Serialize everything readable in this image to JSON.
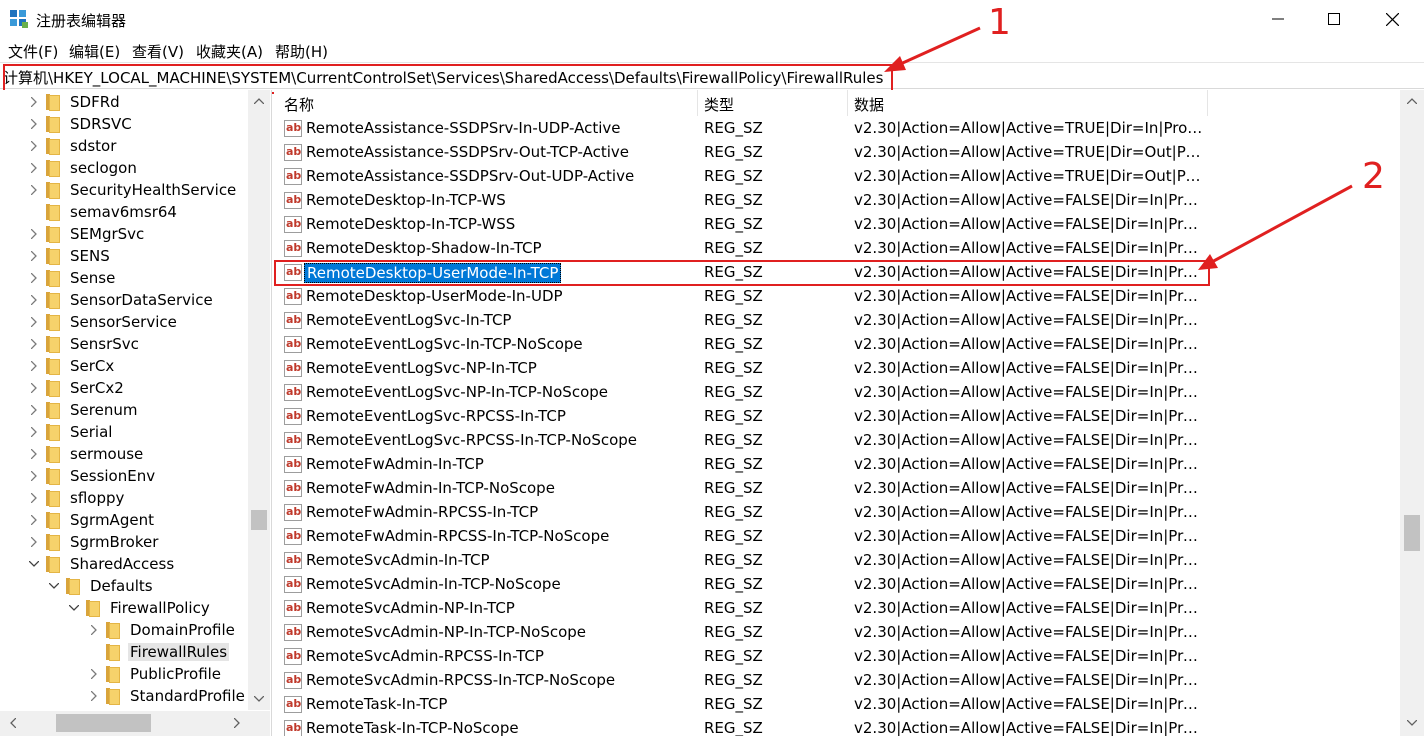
{
  "window": {
    "title": "注册表编辑器"
  },
  "menu": [
    "文件(F)",
    "编辑(E)",
    "查看(V)",
    "收藏夹(A)",
    "帮助(H)"
  ],
  "address": "计算机\\HKEY_LOCAL_MACHINE\\SYSTEM\\CurrentControlSet\\Services\\SharedAccess\\Defaults\\FirewallPolicy\\FirewallRules",
  "tree": [
    {
      "label": "SDFRd",
      "level": 0,
      "expand": "collapsed"
    },
    {
      "label": "SDRSVC",
      "level": 0,
      "expand": "collapsed"
    },
    {
      "label": "sdstor",
      "level": 0,
      "expand": "collapsed"
    },
    {
      "label": "seclogon",
      "level": 0,
      "expand": "collapsed"
    },
    {
      "label": "SecurityHealthService",
      "level": 0,
      "expand": "collapsed"
    },
    {
      "label": "semav6msr64",
      "level": 0,
      "expand": "none"
    },
    {
      "label": "SEMgrSvc",
      "level": 0,
      "expand": "collapsed"
    },
    {
      "label": "SENS",
      "level": 0,
      "expand": "collapsed"
    },
    {
      "label": "Sense",
      "level": 0,
      "expand": "collapsed"
    },
    {
      "label": "SensorDataService",
      "level": 0,
      "expand": "collapsed"
    },
    {
      "label": "SensorService",
      "level": 0,
      "expand": "collapsed"
    },
    {
      "label": "SensrSvc",
      "level": 0,
      "expand": "collapsed"
    },
    {
      "label": "SerCx",
      "level": 0,
      "expand": "collapsed"
    },
    {
      "label": "SerCx2",
      "level": 0,
      "expand": "collapsed"
    },
    {
      "label": "Serenum",
      "level": 0,
      "expand": "collapsed"
    },
    {
      "label": "Serial",
      "level": 0,
      "expand": "collapsed"
    },
    {
      "label": "sermouse",
      "level": 0,
      "expand": "collapsed"
    },
    {
      "label": "SessionEnv",
      "level": 0,
      "expand": "collapsed"
    },
    {
      "label": "sfloppy",
      "level": 0,
      "expand": "collapsed"
    },
    {
      "label": "SgrmAgent",
      "level": 0,
      "expand": "collapsed"
    },
    {
      "label": "SgrmBroker",
      "level": 0,
      "expand": "collapsed"
    },
    {
      "label": "SharedAccess",
      "level": 0,
      "expand": "expanded"
    },
    {
      "label": "Defaults",
      "level": 1,
      "expand": "expanded"
    },
    {
      "label": "FirewallPolicy",
      "level": 2,
      "expand": "expanded"
    },
    {
      "label": "DomainProfile",
      "level": 3,
      "expand": "collapsed"
    },
    {
      "label": "FirewallRules",
      "level": 3,
      "expand": "none",
      "selected": true
    },
    {
      "label": "PublicProfile",
      "level": 3,
      "expand": "collapsed"
    },
    {
      "label": "StandardProfile",
      "level": 3,
      "expand": "collapsed"
    }
  ],
  "columns": {
    "name": "名称",
    "type": "类型",
    "data": "数据"
  },
  "rows": [
    {
      "name": "RemoteAssistance-SSDPSrv-In-UDP-Active",
      "type": "REG_SZ",
      "data": "v2.30|Action=Allow|Active=TRUE|Dir=In|Proto..."
    },
    {
      "name": "RemoteAssistance-SSDPSrv-Out-TCP-Active",
      "type": "REG_SZ",
      "data": "v2.30|Action=Allow|Active=TRUE|Dir=Out|Pro..."
    },
    {
      "name": "RemoteAssistance-SSDPSrv-Out-UDP-Active",
      "type": "REG_SZ",
      "data": "v2.30|Action=Allow|Active=TRUE|Dir=Out|Pro..."
    },
    {
      "name": "RemoteDesktop-In-TCP-WS",
      "type": "REG_SZ",
      "data": "v2.30|Action=Allow|Active=FALSE|Dir=In|Prot..."
    },
    {
      "name": "RemoteDesktop-In-TCP-WSS",
      "type": "REG_SZ",
      "data": "v2.30|Action=Allow|Active=FALSE|Dir=In|Prot..."
    },
    {
      "name": "RemoteDesktop-Shadow-In-TCP",
      "type": "REG_SZ",
      "data": "v2.30|Action=Allow|Active=FALSE|Dir=In|Prot..."
    },
    {
      "name": "RemoteDesktop-UserMode-In-TCP",
      "type": "REG_SZ",
      "data": "v2.30|Action=Allow|Active=FALSE|Dir=In|Prot...",
      "selected": true
    },
    {
      "name": "RemoteDesktop-UserMode-In-UDP",
      "type": "REG_SZ",
      "data": "v2.30|Action=Allow|Active=FALSE|Dir=In|Prot..."
    },
    {
      "name": "RemoteEventLogSvc-In-TCP",
      "type": "REG_SZ",
      "data": "v2.30|Action=Allow|Active=FALSE|Dir=In|Prot..."
    },
    {
      "name": "RemoteEventLogSvc-In-TCP-NoScope",
      "type": "REG_SZ",
      "data": "v2.30|Action=Allow|Active=FALSE|Dir=In|Prot..."
    },
    {
      "name": "RemoteEventLogSvc-NP-In-TCP",
      "type": "REG_SZ",
      "data": "v2.30|Action=Allow|Active=FALSE|Dir=In|Prot..."
    },
    {
      "name": "RemoteEventLogSvc-NP-In-TCP-NoScope",
      "type": "REG_SZ",
      "data": "v2.30|Action=Allow|Active=FALSE|Dir=In|Prot..."
    },
    {
      "name": "RemoteEventLogSvc-RPCSS-In-TCP",
      "type": "REG_SZ",
      "data": "v2.30|Action=Allow|Active=FALSE|Dir=In|Prot..."
    },
    {
      "name": "RemoteEventLogSvc-RPCSS-In-TCP-NoScope",
      "type": "REG_SZ",
      "data": "v2.30|Action=Allow|Active=FALSE|Dir=In|Prot..."
    },
    {
      "name": "RemoteFwAdmin-In-TCP",
      "type": "REG_SZ",
      "data": "v2.30|Action=Allow|Active=FALSE|Dir=In|Prot..."
    },
    {
      "name": "RemoteFwAdmin-In-TCP-NoScope",
      "type": "REG_SZ",
      "data": "v2.30|Action=Allow|Active=FALSE|Dir=In|Prot..."
    },
    {
      "name": "RemoteFwAdmin-RPCSS-In-TCP",
      "type": "REG_SZ",
      "data": "v2.30|Action=Allow|Active=FALSE|Dir=In|Prot..."
    },
    {
      "name": "RemoteFwAdmin-RPCSS-In-TCP-NoScope",
      "type": "REG_SZ",
      "data": "v2.30|Action=Allow|Active=FALSE|Dir=In|Prot..."
    },
    {
      "name": "RemoteSvcAdmin-In-TCP",
      "type": "REG_SZ",
      "data": "v2.30|Action=Allow|Active=FALSE|Dir=In|Prot..."
    },
    {
      "name": "RemoteSvcAdmin-In-TCP-NoScope",
      "type": "REG_SZ",
      "data": "v2.30|Action=Allow|Active=FALSE|Dir=In|Prot..."
    },
    {
      "name": "RemoteSvcAdmin-NP-In-TCP",
      "type": "REG_SZ",
      "data": "v2.30|Action=Allow|Active=FALSE|Dir=In|Prot..."
    },
    {
      "name": "RemoteSvcAdmin-NP-In-TCP-NoScope",
      "type": "REG_SZ",
      "data": "v2.30|Action=Allow|Active=FALSE|Dir=In|Prot..."
    },
    {
      "name": "RemoteSvcAdmin-RPCSS-In-TCP",
      "type": "REG_SZ",
      "data": "v2.30|Action=Allow|Active=FALSE|Dir=In|Prot..."
    },
    {
      "name": "RemoteSvcAdmin-RPCSS-In-TCP-NoScope",
      "type": "REG_SZ",
      "data": "v2.30|Action=Allow|Active=FALSE|Dir=In|Prot..."
    },
    {
      "name": "RemoteTask-In-TCP",
      "type": "REG_SZ",
      "data": "v2.30|Action=Allow|Active=FALSE|Dir=In|Prot..."
    },
    {
      "name": "RemoteTask-In-TCP-NoScope",
      "type": "REG_SZ",
      "data": "v2.30|Action=Allow|Active=FALSE|Dir=In|Prot..."
    }
  ],
  "value_icon_text": "ab",
  "annotations": [
    "1",
    "2"
  ],
  "colors": {
    "annotation": "#e02020",
    "selection": "#0078d7",
    "folder": "#f6d26b"
  }
}
